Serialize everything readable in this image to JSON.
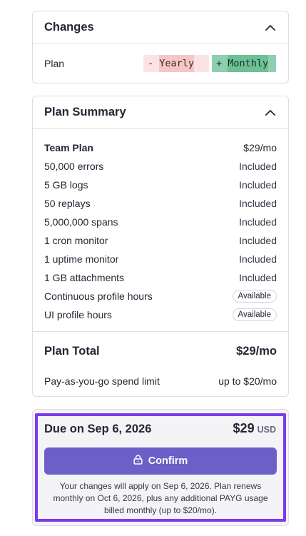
{
  "changes": {
    "title": "Changes",
    "row_label": "Plan",
    "old_prefix": "-",
    "old_value": "Yearly",
    "new_prefix": "+",
    "new_value": "Monthly"
  },
  "summary": {
    "title": "Plan Summary",
    "items": [
      {
        "name": "Team Plan",
        "value": "$29/mo"
      },
      {
        "name": "50,000 errors",
        "value": "Included"
      },
      {
        "name": "5 GB logs",
        "value": "Included"
      },
      {
        "name": "50 replays",
        "value": "Included"
      },
      {
        "name": "5,000,000 spans",
        "value": "Included"
      },
      {
        "name": "1 cron monitor",
        "value": "Included"
      },
      {
        "name": "1 uptime monitor",
        "value": "Included"
      },
      {
        "name": "1 GB attachments",
        "value": "Included"
      },
      {
        "name": "Continuous profile hours",
        "value": "Available"
      },
      {
        "name": "UI profile hours",
        "value": "Available"
      }
    ],
    "total_label": "Plan Total",
    "total_value": "$29/mo",
    "spend_label": "Pay-as-you-go spend limit",
    "spend_value": "up to $20/mo"
  },
  "due": {
    "title": "Due on Sep 6, 2026",
    "amount": "$29",
    "currency": "USD",
    "confirm_label": "Confirm",
    "note": "Your changes will apply on Sep 6, 2026. Plan renews monthly on Oct 6, 2026, plus any additional PAYG usage billed monthly (up to $20/mo)."
  },
  "icons": {
    "collapse": "chevron-up-icon",
    "confirm": "lock-icon"
  },
  "colors": {
    "accent": "#6c5fc7",
    "focus": "#7c3aed",
    "diff_removed": "#fbe3e3",
    "diff_added": "#8fcfb0"
  }
}
